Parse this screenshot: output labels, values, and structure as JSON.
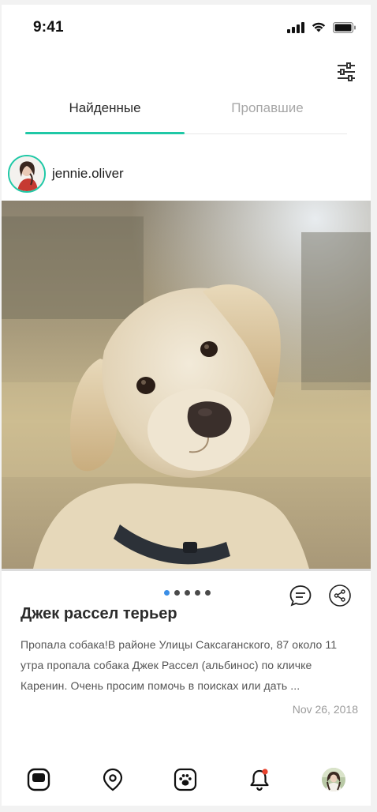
{
  "status_bar": {
    "time": "9:41"
  },
  "tabs": [
    {
      "label": "Найденные",
      "active": true
    },
    {
      "label": "Пропавшие",
      "active": false
    }
  ],
  "post": {
    "author": "jennie.oliver",
    "title": "Джек рассел терьер",
    "description": "Пропала собака!В районе Улицы Саксаганского, 87 около 11 утра пропала собака Джек Рассел (альбинос)  по кличке Каренин. Очень просим помочь в поисках или дать ...",
    "date": "Nov 26, 2018",
    "photo_count": 5,
    "current_photo": 1
  },
  "icons": {
    "filter": "sliders-icon",
    "comment": "comment-icon",
    "share": "share-icon",
    "nav": [
      "home-icon",
      "location-pin-icon",
      "paw-icon",
      "bell-icon",
      "profile-avatar"
    ]
  },
  "colors": {
    "accent": "#1fc8a6",
    "active_dot": "#3a8ee6",
    "notification_dot": "#e8432e"
  }
}
